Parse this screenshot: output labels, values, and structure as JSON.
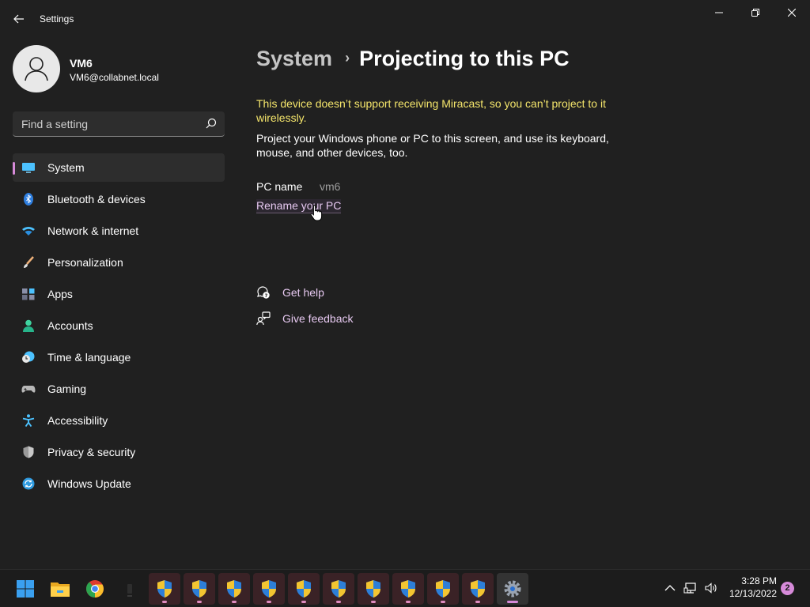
{
  "window": {
    "title": "Settings",
    "controls": {
      "minimize_icon": "minimize-icon",
      "maximize_icon": "restore-icon",
      "close_icon": "close-icon"
    }
  },
  "user": {
    "name": "VM6",
    "email": "VM6@collabnet.local"
  },
  "search": {
    "placeholder": "Find a setting",
    "value": ""
  },
  "sidebar": {
    "items": [
      {
        "label": "System",
        "icon": "monitor-icon",
        "active": true
      },
      {
        "label": "Bluetooth & devices",
        "icon": "bluetooth-icon"
      },
      {
        "label": "Network & internet",
        "icon": "wifi-icon"
      },
      {
        "label": "Personalization",
        "icon": "paintbrush-icon"
      },
      {
        "label": "Apps",
        "icon": "apps-icon"
      },
      {
        "label": "Accounts",
        "icon": "person-icon"
      },
      {
        "label": "Time & language",
        "icon": "clock-globe-icon"
      },
      {
        "label": "Gaming",
        "icon": "gamepad-icon"
      },
      {
        "label": "Accessibility",
        "icon": "accessibility-icon"
      },
      {
        "label": "Privacy & security",
        "icon": "shield-icon"
      },
      {
        "label": "Windows Update",
        "icon": "update-icon"
      }
    ]
  },
  "content": {
    "breadcrumb_parent": "System",
    "breadcrumb_separator": "›",
    "page_title": "Projecting to this PC",
    "warning": "This device doesn’t support receiving Miracast, so you can’t project to it wirelessly.",
    "description": "Project your Windows phone or PC to this screen, and use its keyboard, mouse, and other devices, too.",
    "pc_name_label": "PC name",
    "pc_name_value": "vm6",
    "rename_link": "Rename your PC",
    "get_help": "Get help",
    "give_feedback": "Give feedback"
  },
  "taskbar": {
    "apps": [
      "start-icon",
      "file-explorer-icon",
      "chrome-icon",
      "blank-app-icon",
      "uac-shield-icon",
      "uac-shield-icon",
      "uac-shield-icon",
      "uac-shield-icon",
      "uac-shield-icon",
      "uac-shield-icon",
      "uac-shield-icon",
      "uac-shield-icon",
      "uac-shield-icon",
      "uac-shield-icon",
      "settings-gear-icon"
    ],
    "time": "3:28 PM",
    "date": "12/13/2022",
    "notification_count": "2"
  },
  "colors": {
    "background": "#202020",
    "accent": "#d68ad9",
    "warning_text": "#f4e56b",
    "link_text": "#e6c8f0"
  }
}
